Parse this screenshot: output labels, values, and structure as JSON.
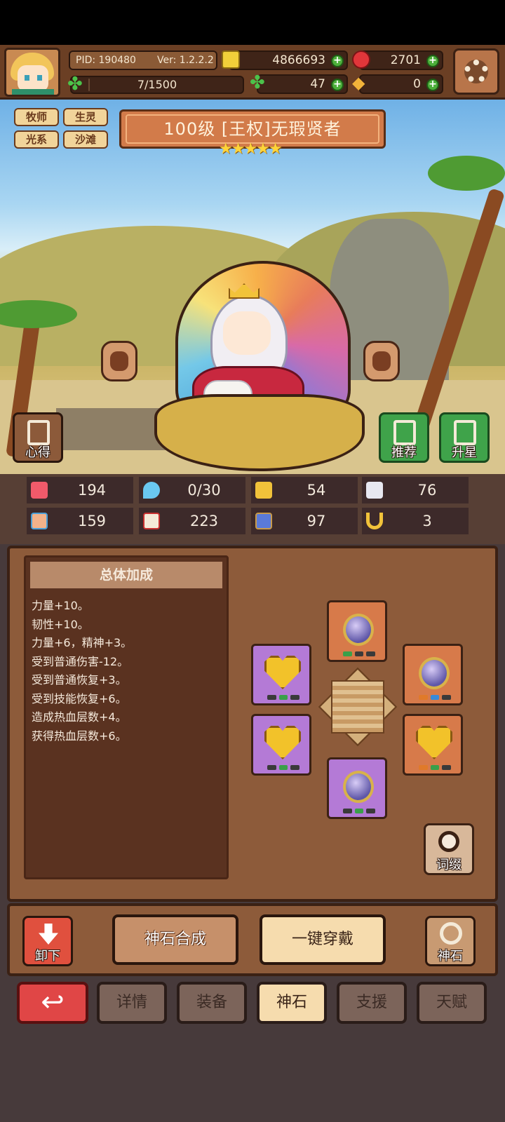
{
  "header": {
    "pid": "PID: 190480",
    "version": "Ver: 1.2.2.2",
    "gold": "4866693",
    "gems": "2701",
    "exp": "7/1500",
    "exp_progress": 0.0047,
    "clover": "47",
    "tickets": "0"
  },
  "hero": {
    "tags": [
      "牧师",
      "生灵",
      "光系",
      "沙滩"
    ],
    "title": "100级 [王权]无瑕贤者",
    "stars": 5,
    "star_text": "★★★★★"
  },
  "scene_buttons": {
    "insight": "心得",
    "recommend": "推荐",
    "star_up": "升星"
  },
  "stats": [
    {
      "icon": "heart-icon",
      "value": "194"
    },
    {
      "icon": "water-drop-icon",
      "value": "0/30"
    },
    {
      "icon": "shield-icon",
      "value": "54"
    },
    {
      "icon": "wing-icon",
      "value": "76"
    },
    {
      "icon": "fist-icon",
      "value": "159"
    },
    {
      "icon": "book-icon",
      "value": "223"
    },
    {
      "icon": "boot-icon",
      "value": "97"
    },
    {
      "icon": "horseshoe-icon",
      "value": "3"
    }
  ],
  "bonus": {
    "title": "总体加成",
    "lines": [
      "力量+10。",
      "韧性+10。",
      "力量+6，精神+3。",
      "受到普通伤害-12。",
      "受到普通恢复+3。",
      "受到技能恢复+6。",
      "造成热血层数+4。",
      "获得热血层数+6。"
    ]
  },
  "gem_panel": {
    "affix": "词缀"
  },
  "actions": {
    "unequip": "卸下",
    "synthesize": "神石合成",
    "equip_all": "一键穿戴",
    "godstone": "神石"
  },
  "tabs": [
    "详情",
    "装备",
    "神石",
    "支援",
    "天赋"
  ],
  "active_tab": "神石",
  "back_icon": "↩",
  "colors": {
    "panel": "#8d5b3a",
    "accent_green": "#4caf3a",
    "accent_red": "#e04646",
    "active_tab": "#f6dcae"
  }
}
